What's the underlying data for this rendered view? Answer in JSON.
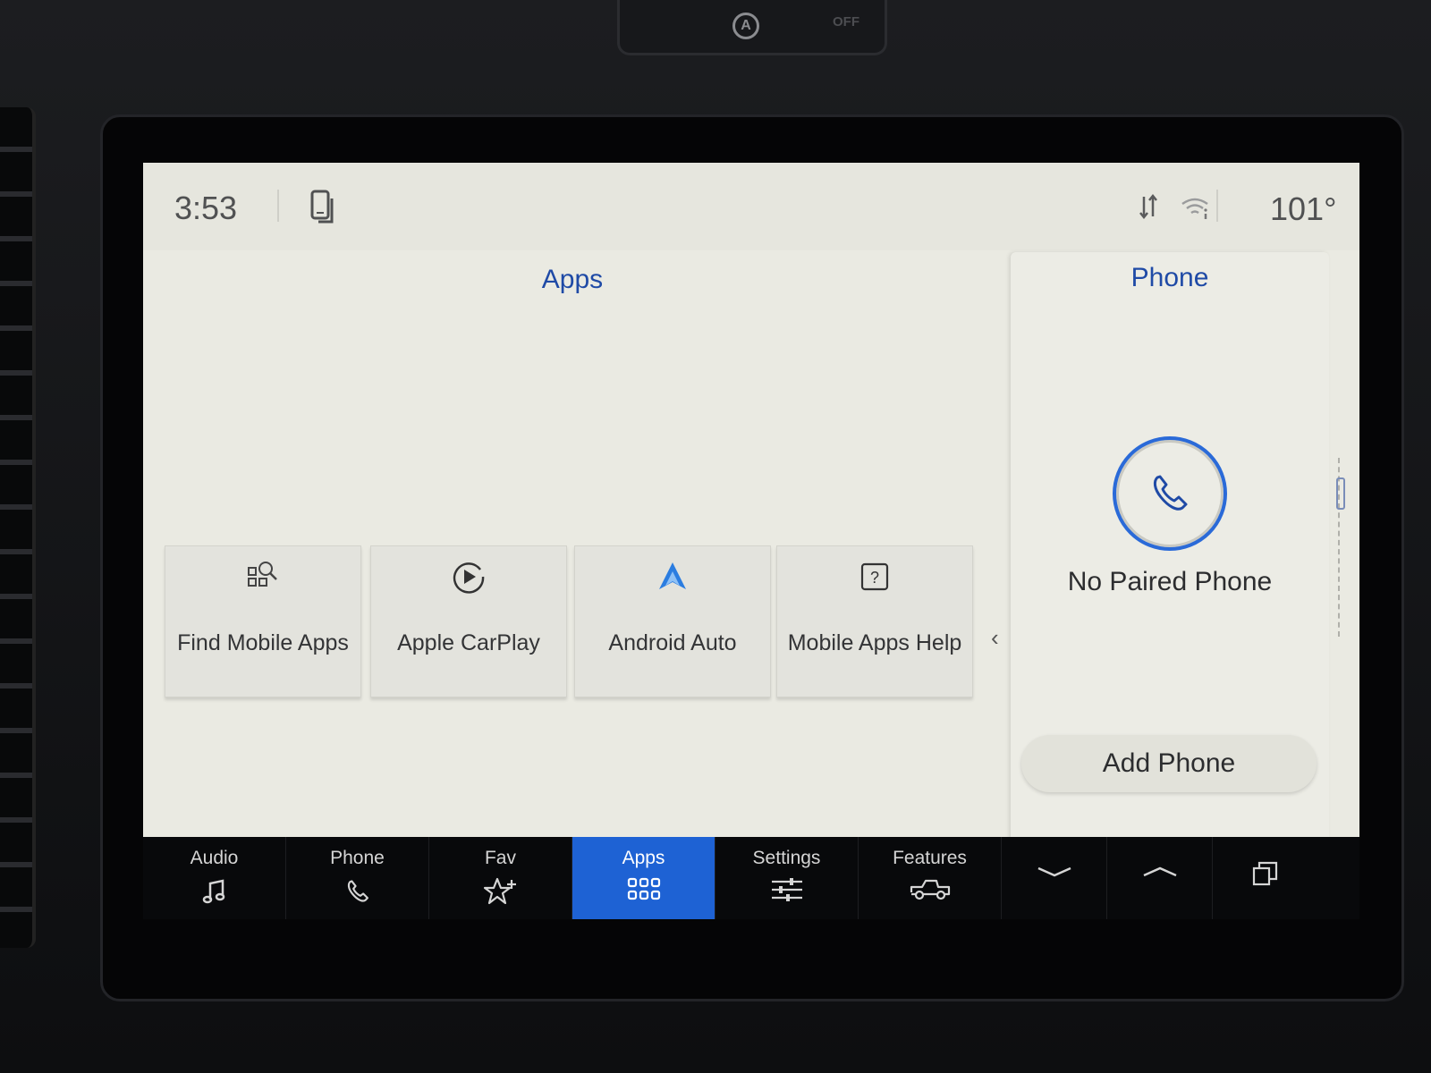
{
  "status": {
    "time": "3:53",
    "temperature": "101°",
    "icons": [
      "phone-status-icon",
      "sync-arrows-icon",
      "wifi-icon"
    ]
  },
  "hardware": {
    "hazard_a": "A",
    "hazard_off": "OFF"
  },
  "apps": {
    "title": "Apps",
    "tiles": [
      {
        "label": "Find Mobile Apps",
        "icon": "find-apps-icon"
      },
      {
        "label": "Apple CarPlay",
        "icon": "play-circle-icon"
      },
      {
        "label": "Android Auto",
        "icon": "android-auto-icon"
      },
      {
        "label": "Mobile Apps Help",
        "icon": "help-icon"
      }
    ]
  },
  "phone_card": {
    "title": "Phone",
    "status": "No Paired Phone",
    "add_button": "Add Phone"
  },
  "nav": {
    "items": [
      {
        "label": "Audio",
        "icon": "music-note-icon"
      },
      {
        "label": "Phone",
        "icon": "phone-icon"
      },
      {
        "label": "Fav",
        "icon": "star-plus-icon"
      },
      {
        "label": "Apps",
        "icon": "apps-grid-icon",
        "active": true
      },
      {
        "label": "Settings",
        "icon": "sliders-icon"
      },
      {
        "label": "Features",
        "icon": "truck-icon"
      }
    ],
    "extra_icons": [
      "chevron-down-icon",
      "chevron-up-icon",
      "windows-icon"
    ]
  },
  "colors": {
    "accent": "#1f4aa6",
    "active_nav": "#1e62d4",
    "screen_bg": "#eaeae2"
  }
}
